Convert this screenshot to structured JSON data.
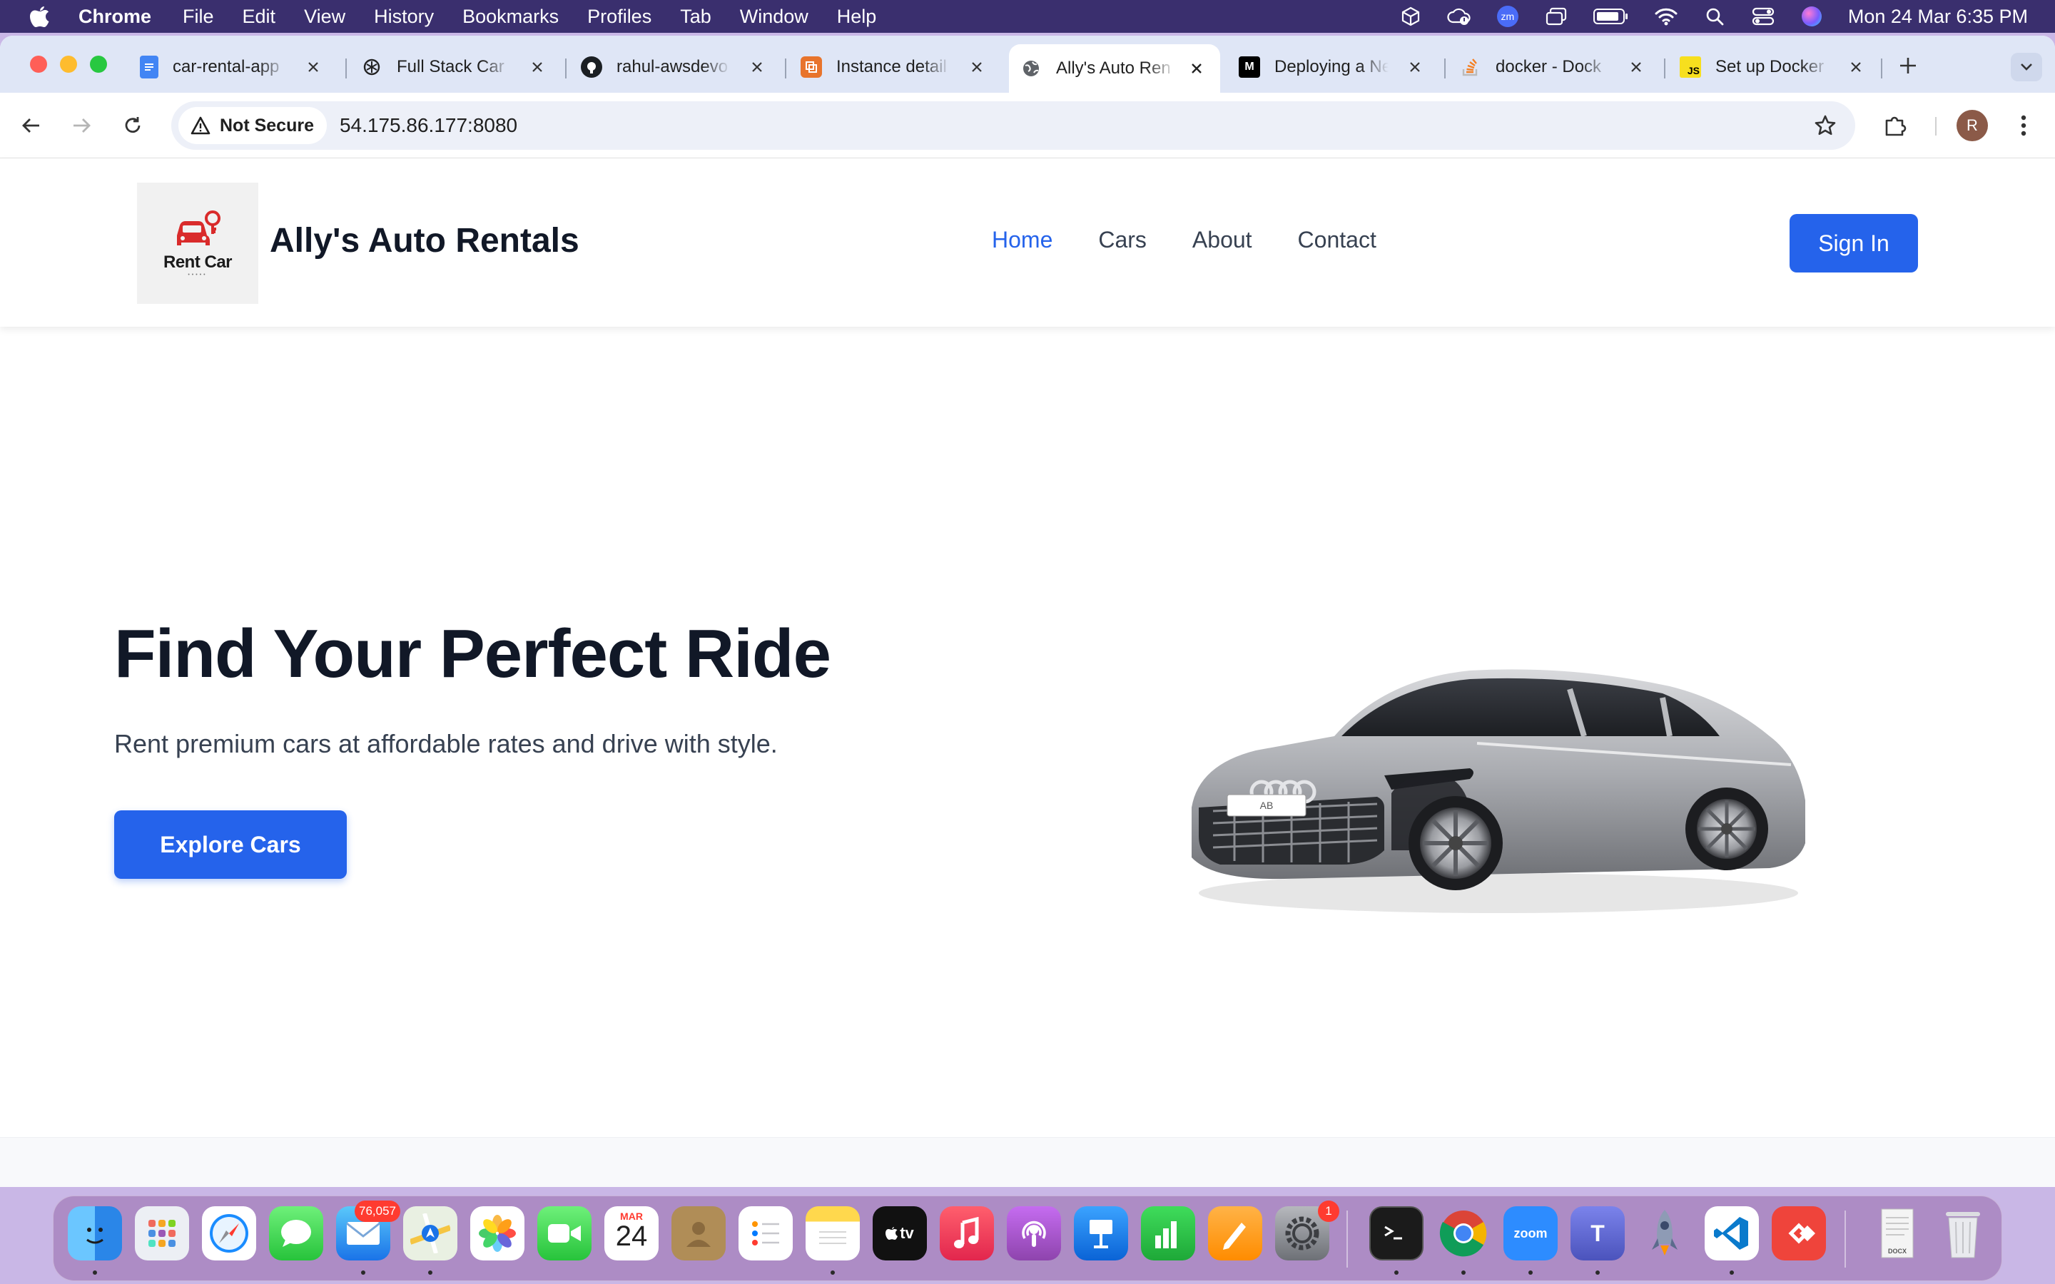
{
  "menubar": {
    "app_name": "Chrome",
    "items": [
      "File",
      "Edit",
      "View",
      "History",
      "Bookmarks",
      "Profiles",
      "Tab",
      "Window",
      "Help"
    ],
    "zoom_label": "zm",
    "clock": "Mon 24 Mar  6:35 PM"
  },
  "browser": {
    "tabs": [
      {
        "title": "car-rental-app",
        "favicon": "google-docs-icon"
      },
      {
        "title": "Full Stack Car",
        "favicon": "chatgpt-icon"
      },
      {
        "title": "rahul-awsdevo",
        "favicon": "github-icon"
      },
      {
        "title": "Instance detail",
        "favicon": "aws-icon"
      },
      {
        "title": "Ally's Auto Ren",
        "favicon": "globe-icon",
        "active": true
      },
      {
        "title": "Deploying a Ne",
        "favicon": "medium-icon",
        "favicon_text": "M"
      },
      {
        "title": "docker - Dock",
        "favicon": "stackoverflow-icon"
      },
      {
        "title": "Set up Docker",
        "favicon": "js-icon",
        "favicon_text": "JS"
      }
    ],
    "security_chip": "Not Secure",
    "url": "54.175.86.177:8080",
    "profile_initial": "R"
  },
  "site": {
    "logo_text": "Rent Car",
    "brand": "Ally's Auto Rentals",
    "nav": [
      {
        "label": "Home",
        "active": true
      },
      {
        "label": "Cars",
        "active": false
      },
      {
        "label": "About",
        "active": false
      },
      {
        "label": "Contact",
        "active": false
      }
    ],
    "sign_in": "Sign In",
    "hero": {
      "title": "Find Your Perfect Ride",
      "subtitle": "Rent premium cars at affordable rates and drive with style.",
      "cta": "Explore Cars",
      "plate": "AB"
    },
    "accent_color": "#2563eb"
  },
  "dock": {
    "mail_badge": "76,057",
    "calendar_month": "MAR",
    "calendar_day": "24",
    "settings_badge": "1",
    "appletv_label": "tv",
    "zoom_label": "zoom",
    "teams_label": "T",
    "apps": [
      "finder",
      "launchpad",
      "safari",
      "messages",
      "mail",
      "maps",
      "photos",
      "facetime",
      "calendar",
      "contacts",
      "reminders",
      "notes",
      "apple-tv",
      "music",
      "podcasts",
      "keynote",
      "numbers",
      "pages",
      "system-settings",
      "terminal",
      "chrome",
      "zoom",
      "teams",
      "rocket",
      "vscode",
      "anydesk",
      "document",
      "trash"
    ]
  }
}
